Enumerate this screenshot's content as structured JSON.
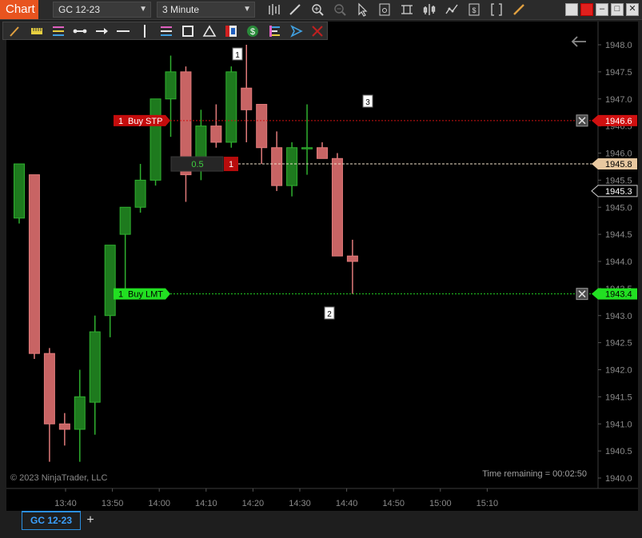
{
  "window": {
    "title": "Chart",
    "instrument": "GC 12-23",
    "interval": "3 Minute"
  },
  "chart": {
    "copyright": "© 2023 NinjaTrader, LLC",
    "time_remaining": "Time remaining = 00:02:50",
    "price_ticks": [
      "1948.0",
      "1947.5",
      "1947.0",
      "1946.5",
      "1946.0",
      "1945.5",
      "1945.0",
      "1944.5",
      "1944.0",
      "1943.5",
      "1943.0",
      "1942.5",
      "1942.0",
      "1941.5",
      "1941.0",
      "1940.5",
      "1940.0"
    ],
    "time_ticks": [
      "13:40",
      "13:50",
      "14:00",
      "14:10",
      "14:20",
      "14:30",
      "14:40",
      "14:50",
      "15:00",
      "15:10"
    ],
    "orders": {
      "stop": {
        "qty": "1",
        "label": "Buy STP",
        "price": "1946.6"
      },
      "limit": {
        "qty": "1",
        "label": "Buy LMT",
        "price": "1943.4"
      }
    },
    "position": {
      "pnl": "0.5",
      "qty": "1",
      "price": "1945.8"
    },
    "last_price": "1945.3",
    "markers": [
      "1",
      "2",
      "3"
    ],
    "colors": {
      "up": "#1e7a1e",
      "up_border": "#2fb02f",
      "down": "#c86464",
      "down_border": "#e07a7a",
      "stop": "#d01010",
      "limit": "#22e022",
      "position": "#e8c8a0"
    }
  },
  "chart_data": {
    "type": "candlestick",
    "x": [
      "13:38",
      "13:41",
      "13:44",
      "13:47",
      "13:50",
      "13:53",
      "13:56",
      "13:59",
      "14:02",
      "14:05",
      "14:08",
      "14:11",
      "14:14",
      "14:17",
      "14:20",
      "14:23",
      "14:26",
      "14:29",
      "14:32",
      "14:35",
      "14:38",
      "14:41",
      "14:44"
    ],
    "candles": [
      {
        "o": 1944.8,
        "h": 1945.8,
        "l": 1944.7,
        "c": 1945.8
      },
      {
        "o": 1945.6,
        "h": 1945.6,
        "l": 1942.2,
        "c": 1942.3
      },
      {
        "o": 1942.3,
        "h": 1942.4,
        "l": 1940.3,
        "c": 1941.0
      },
      {
        "o": 1941.0,
        "h": 1941.2,
        "l": 1940.6,
        "c": 1940.9
      },
      {
        "o": 1940.9,
        "h": 1942.0,
        "l": 1940.3,
        "c": 1941.5
      },
      {
        "o": 1941.4,
        "h": 1943.0,
        "l": 1940.8,
        "c": 1942.7
      },
      {
        "o": 1943.0,
        "h": 1944.3,
        "l": 1942.6,
        "c": 1944.3
      },
      {
        "o": 1944.5,
        "h": 1945.0,
        "l": 1943.4,
        "c": 1945.0
      },
      {
        "o": 1945.0,
        "h": 1945.8,
        "l": 1944.9,
        "c": 1945.5
      },
      {
        "o": 1945.5,
        "h": 1947.0,
        "l": 1945.4,
        "c": 1947.0
      },
      {
        "o": 1947.0,
        "h": 1947.8,
        "l": 1946.3,
        "c": 1947.5
      },
      {
        "o": 1947.5,
        "h": 1947.6,
        "l": 1945.1,
        "c": 1945.6
      },
      {
        "o": 1945.7,
        "h": 1946.8,
        "l": 1945.5,
        "c": 1946.5
      },
      {
        "o": 1946.5,
        "h": 1946.9,
        "l": 1946.1,
        "c": 1946.2
      },
      {
        "o": 1946.2,
        "h": 1947.6,
        "l": 1946.1,
        "c": 1947.5
      },
      {
        "o": 1947.2,
        "h": 1948.0,
        "l": 1946.2,
        "c": 1946.8
      },
      {
        "o": 1946.9,
        "h": 1946.9,
        "l": 1945.8,
        "c": 1946.1
      },
      {
        "o": 1946.1,
        "h": 1946.4,
        "l": 1945.3,
        "c": 1945.4
      },
      {
        "o": 1945.4,
        "h": 1946.2,
        "l": 1945.2,
        "c": 1946.1
      },
      {
        "o": 1946.1,
        "h": 1946.9,
        "l": 1945.6,
        "c": 1946.1
      },
      {
        "o": 1946.1,
        "h": 1946.2,
        "l": 1945.9,
        "c": 1945.9
      },
      {
        "o": 1945.9,
        "h": 1946.0,
        "l": 1944.1,
        "c": 1944.1
      },
      {
        "o": 1944.1,
        "h": 1944.4,
        "l": 1943.4,
        "c": 1944.0
      }
    ],
    "ylim": [
      1939.9,
      1948.4
    ]
  },
  "toolbar": {
    "icons": [
      "bars-icon",
      "pencil-icon",
      "zoom-in-icon",
      "zoom-out-icon",
      "pointer-icon",
      "properties-icon",
      "chart-trader-icon",
      "strategy-icon",
      "indicators-icon",
      "data-box-icon",
      "ruler-icon"
    ]
  },
  "tabs": [
    {
      "label": "GC 12-23"
    }
  ],
  "add_tab": "+"
}
